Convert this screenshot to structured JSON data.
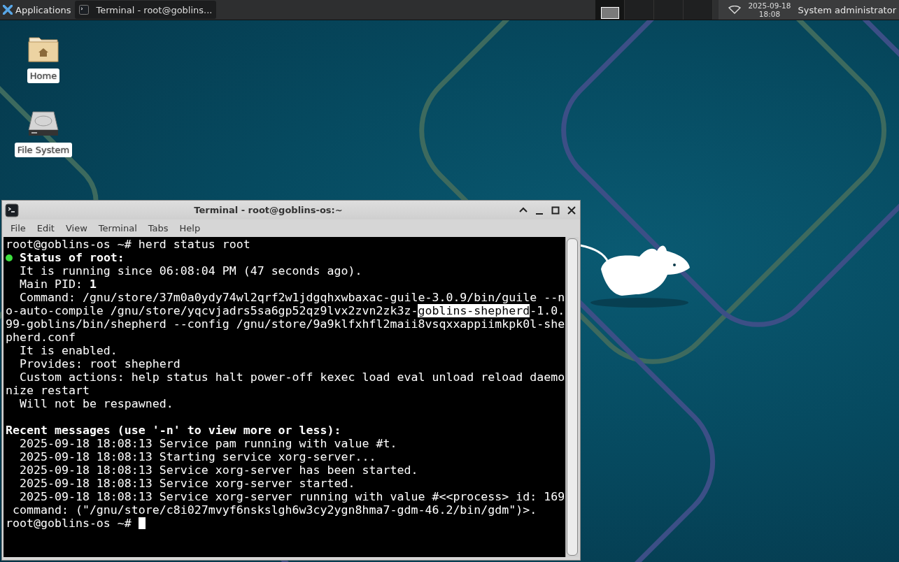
{
  "panel": {
    "menu_label": "Applications",
    "tasks": [
      {
        "label": "Terminal - root@goblins...",
        "selected": true
      }
    ],
    "workspaces": [
      {
        "selected": true,
        "has_window": true
      },
      {
        "selected": false,
        "has_window": false
      },
      {
        "selected": false,
        "has_window": false
      },
      {
        "selected": false,
        "has_window": false
      }
    ],
    "clock": {
      "date": "2025-09-18",
      "time": "18:08"
    },
    "user": "System administrator"
  },
  "desktop_icons": [
    {
      "kind": "home",
      "label": "Home"
    },
    {
      "kind": "drive",
      "label": "File System"
    }
  ],
  "terminal": {
    "title": "Terminal - root@goblins-os:~",
    "menu": [
      "File",
      "Edit",
      "View",
      "Terminal",
      "Tabs",
      "Help"
    ],
    "lines": [
      {
        "text": "root@goblins-os ~# herd status root"
      },
      {
        "dot": true,
        "bold": true,
        "text": "Status of root:"
      },
      {
        "text": "  It is running since 06:08:04 PM (47 seconds ago)."
      },
      {
        "text": "  Main PID: **1**"
      },
      {
        "text": "  Command: /gnu/store/37m0a0ydy74wl2qrf2w1jdgqhxwbaxac-guile-3.0.9/bin/guile --n"
      },
      {
        "parts": [
          {
            "text": "o-auto-compile /gnu/store/yqcvjadrs5sa6gp52qz9lvx2zvn2zk3z-",
            "selected": false
          },
          {
            "text": "goblins-shepherd",
            "selected": true
          },
          {
            "text": "-1.0.",
            "selected": false
          }
        ]
      },
      {
        "text": "99-goblins/bin/shepherd --config /gnu/store/9a9klfxhfl2maii8vsqxxappiimkpk0l-she"
      },
      {
        "text": "pherd.conf"
      },
      {
        "text": "  It is enabled."
      },
      {
        "text": "  Provides: root shepherd"
      },
      {
        "text": "  Custom actions: help status halt power-off kexec load eval unload reload daemo"
      },
      {
        "text": "nize restart"
      },
      {
        "text": "  Will not be respawned."
      }
    ],
    "recent_messages": {
      "heading": "Recent messages (use '-n' to view more or less):",
      "lines": [
        {
          "text": "  2025-09-18 18:08:13 Service pam running with value #t."
        },
        {
          "text": "  2025-09-18 18:08:13 Starting service xorg-server..."
        },
        {
          "text": "  2025-09-18 18:08:13 Service xorg-server has been started."
        },
        {
          "text": "  2025-09-18 18:08:13 Service xorg-server started."
        },
        {
          "text": "  2025-09-18 18:08:13 Service xorg-server running with value #<<process> id: 169"
        },
        {
          "text": " command: (\"/gnu/store/c8i027mvyf6nskslgh6w3cy2ygn8hma7-gdm-46.2/bin/gdm\")>."
        },
        {
          "text": "root@goblins-os ~# ",
          "cursor": true
        }
      ]
    }
  }
}
